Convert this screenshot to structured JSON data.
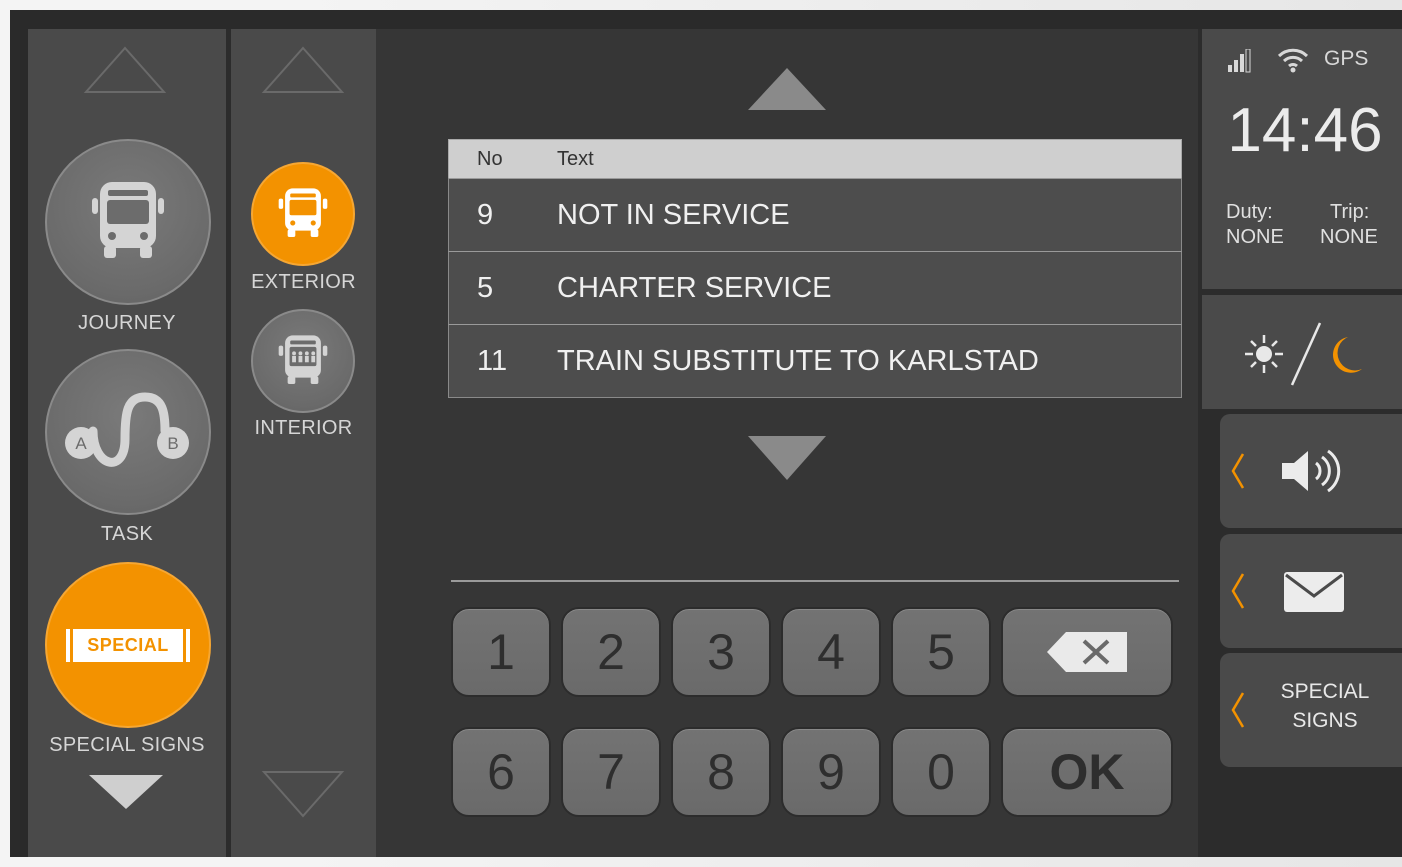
{
  "sidebar": {
    "items": [
      {
        "label": "JOURNEY",
        "icon": "bus-front-icon"
      },
      {
        "label": "TASK",
        "icon": "route-a-b-icon"
      },
      {
        "label": "SPECIAL SIGNS",
        "icon": "special-sign-icon",
        "badge": "SPECIAL"
      }
    ]
  },
  "sign_type": {
    "items": [
      {
        "label": "EXTERIOR",
        "icon": "bus-exterior-icon"
      },
      {
        "label": "INTERIOR",
        "icon": "bus-interior-icon"
      }
    ]
  },
  "table": {
    "headers": {
      "no": "No",
      "text": "Text"
    },
    "rows": [
      {
        "no": "9",
        "text": "NOT IN SERVICE"
      },
      {
        "no": "5",
        "text": "CHARTER SERVICE"
      },
      {
        "no": "11",
        "text": "TRAIN SUBSTITUTE TO KARLSTAD"
      }
    ]
  },
  "keypad": {
    "row1": [
      "1",
      "2",
      "3",
      "4",
      "5"
    ],
    "row2": [
      "6",
      "7",
      "8",
      "9",
      "0"
    ],
    "ok_label": "OK"
  },
  "status": {
    "gps": "GPS",
    "time": "14:46",
    "duty_label": "Duty:",
    "duty_value": "NONE",
    "trip_label": "Trip:",
    "trip_value": "NONE"
  },
  "right_menu": {
    "special_signs_line1": "SPECIAL",
    "special_signs_line2": "SIGNS"
  },
  "colors": {
    "accent": "#f39200",
    "panel": "#4a4a4a",
    "background": "#363636"
  }
}
